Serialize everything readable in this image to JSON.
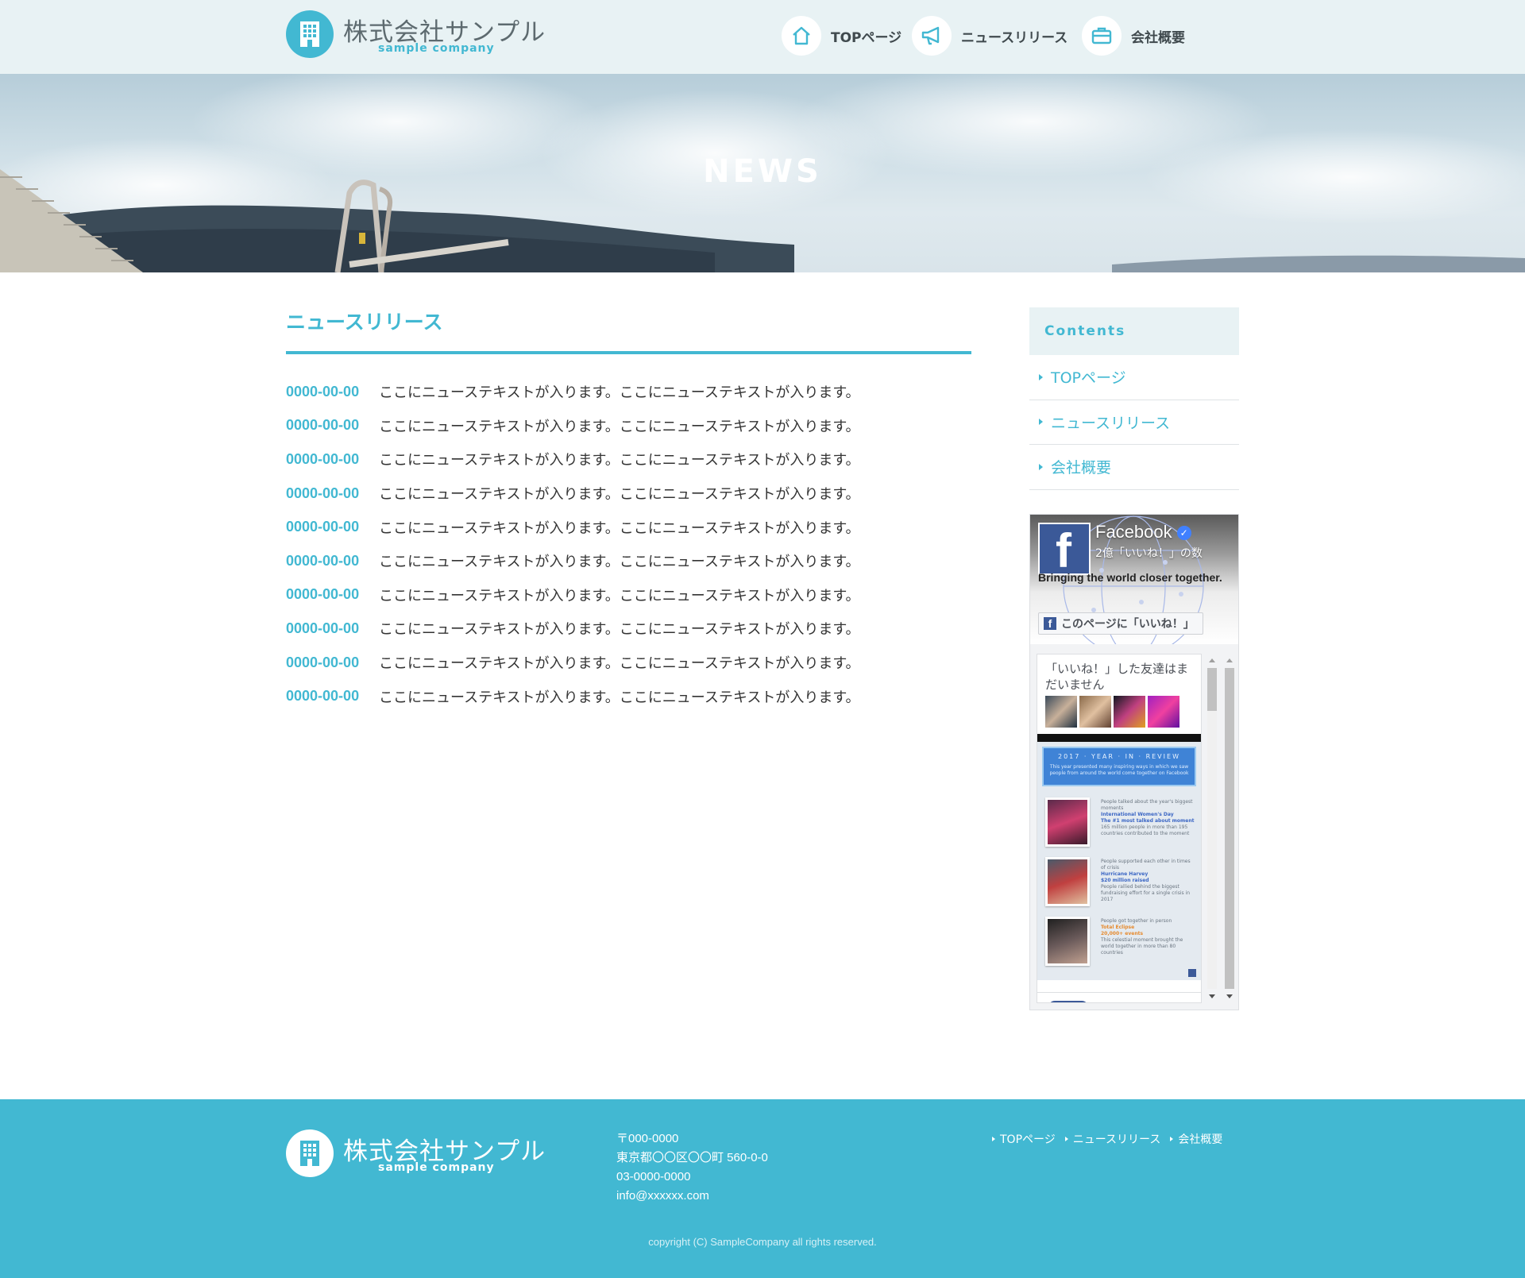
{
  "header": {
    "logo_jp": "株式会社サンプル",
    "logo_en": "sample company",
    "nav": [
      {
        "label": "TOPページ",
        "icon": "home-icon"
      },
      {
        "label": "ニュースリリース",
        "icon": "megaphone-icon"
      },
      {
        "label": "会社概要",
        "icon": "briefcase-icon"
      }
    ]
  },
  "hero": {
    "title": "NEWS"
  },
  "main": {
    "heading": "ニュースリリース",
    "news": [
      {
        "date": "0000-00-00",
        "text": "ここにニューステキストが入ります。ここにニューステキストが入ります。"
      },
      {
        "date": "0000-00-00",
        "text": "ここにニューステキストが入ります。ここにニューステキストが入ります。"
      },
      {
        "date": "0000-00-00",
        "text": "ここにニューステキストが入ります。ここにニューステキストが入ります。"
      },
      {
        "date": "0000-00-00",
        "text": "ここにニューステキストが入ります。ここにニューステキストが入ります。"
      },
      {
        "date": "0000-00-00",
        "text": "ここにニューステキストが入ります。ここにニューステキストが入ります。"
      },
      {
        "date": "0000-00-00",
        "text": "ここにニューステキストが入ります。ここにニューステキストが入ります。"
      },
      {
        "date": "0000-00-00",
        "text": "ここにニューステキストが入ります。ここにニューステキストが入ります。"
      },
      {
        "date": "0000-00-00",
        "text": "ここにニューステキストが入ります。ここにニューステキストが入ります。"
      },
      {
        "date": "0000-00-00",
        "text": "ここにニューステキストが入ります。ここにニューステキストが入ります。"
      },
      {
        "date": "0000-00-00",
        "text": "ここにニューステキストが入ります。ここにニューステキストが入ります。"
      }
    ]
  },
  "sidebar": {
    "heading": "Contents",
    "items": [
      {
        "label": "TOPページ"
      },
      {
        "label": "ニュースリリース"
      },
      {
        "label": "会社概要"
      }
    ],
    "facebook": {
      "page_name": "Facebook",
      "likes": "2億「いいね！」の数",
      "tagline": "Bringing the world closer together.",
      "like_button": "このページに「いいね！」",
      "friends_text": "「いいね！」した友達はまだいません",
      "post_banner_title": "2017 · YEAR · IN · REVIEW",
      "post_banner_text": "This year presented many inspiring ways in which we saw people from around the world come together on Facebook",
      "post_rows": [
        {
          "intro": "People talked about the year's biggest moments",
          "title": "International Women's Day",
          "sub": "The #1 most talked about moment",
          "detail": "165 million people in more than 195 countries contributed to the moment"
        },
        {
          "intro": "People supported each other in times of crisis",
          "title": "Hurricane Harvey",
          "sub": "$20 million raised",
          "detail": "People rallied behind the biggest fundraising effort for a single crisis in 2017"
        },
        {
          "intro": "People got together in person",
          "title": "Total Eclipse",
          "sub": "20,000+ events",
          "detail": "This celestial moment brought the world together in more than 80 countries"
        }
      ]
    }
  },
  "footer": {
    "logo_jp": "株式会社サンプル",
    "logo_en": "sample company",
    "postal": "〒000-0000",
    "address": "東京都〇〇区〇〇町 560-0-0",
    "phone": "03-0000-0000",
    "email": "info@xxxxxx.com",
    "nav": [
      {
        "label": "TOPページ"
      },
      {
        "label": "ニュースリリース"
      },
      {
        "label": "会社概要"
      }
    ],
    "copyright": "copyright (C) SampleCompany all rights reserved."
  },
  "colors": {
    "accent": "#42b8d2",
    "header_bg": "#e8f2f4",
    "text": "#333333",
    "facebook_blue": "#3b5998"
  }
}
